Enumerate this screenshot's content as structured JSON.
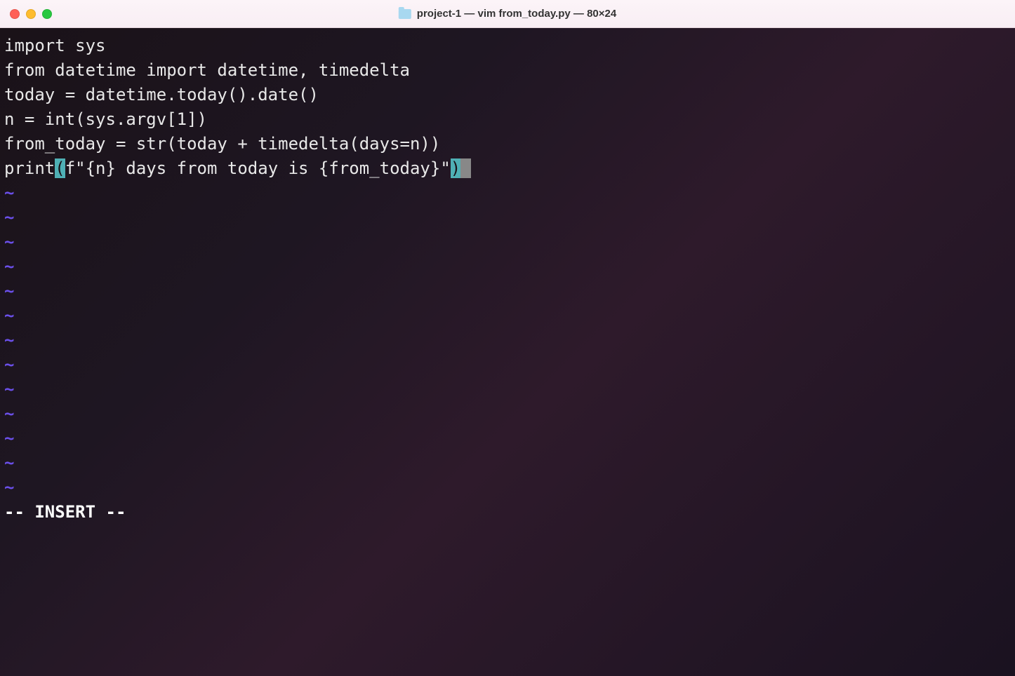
{
  "titlebar": {
    "title": "project-1 — vim from_today.py — 80×24"
  },
  "editor": {
    "lines": {
      "l1": "import sys",
      "l2": "from datetime import datetime, timedelta",
      "l3": "",
      "l4": "today = datetime.today().date()",
      "l5": "",
      "l6": "n = int(sys.argv[1])",
      "l7": "",
      "l8": "from_today = str(today + timedelta(days=n))",
      "l9": "",
      "l10_pre": "print",
      "l10_open": "(",
      "l10_mid": "f\"{n} days from today is {from_today}\"",
      "l10_close": ")",
      "l10_cursor": " "
    },
    "tilde": "~",
    "status": "-- INSERT --"
  }
}
